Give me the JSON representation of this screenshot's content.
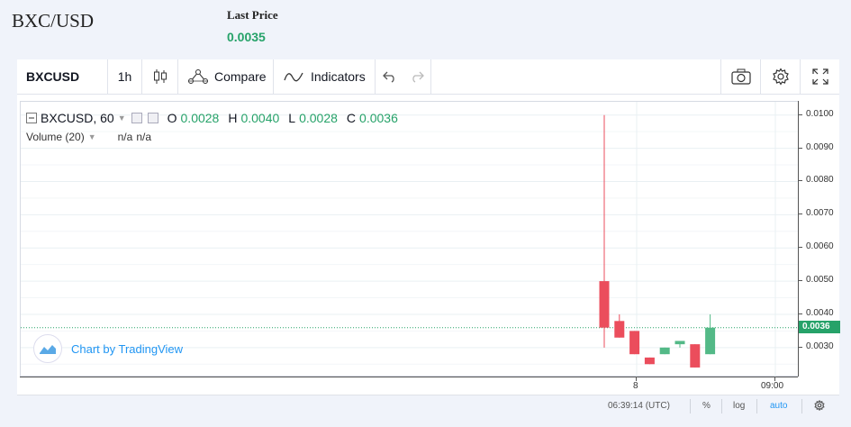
{
  "header": {
    "pair": "BXC/USD",
    "last_price_label": "Last Price",
    "last_price_value": "0.0035"
  },
  "toolbar": {
    "symbol": "BXCUSD",
    "interval": "1h",
    "compare_label": "Compare",
    "indicators_label": "Indicators"
  },
  "legend": {
    "symbol": "BXCUSD, 60",
    "o_label": "O",
    "o_value": "0.0028",
    "h_label": "H",
    "h_value": "0.0040",
    "l_label": "L",
    "l_value": "0.0028",
    "c_label": "C",
    "c_value": "0.0036",
    "volume_label": "Volume (20)",
    "volume_na1": "n/a",
    "volume_na2": "n/a"
  },
  "watermark": "Chart by TradingView",
  "bottom_bar": {
    "time": "06:39:14 (UTC)",
    "percent": "%",
    "log": "log",
    "auto": "auto"
  },
  "chart_data": {
    "type": "candlestick",
    "price_ticks": [
      "0.0100",
      "0.0090",
      "0.0080",
      "0.0070",
      "0.0060",
      "0.0050",
      "0.0040",
      "0.0030"
    ],
    "ylim": [
      0.0021,
      0.0104
    ],
    "time_ticks": [
      "8",
      "09:00"
    ],
    "current_price": "0.0036",
    "candles": [
      {
        "o": 0.005,
        "h": 0.01,
        "l": 0.003,
        "c": 0.0036
      },
      {
        "o": 0.0038,
        "h": 0.004,
        "l": 0.0033,
        "c": 0.0033
      },
      {
        "o": 0.0035,
        "h": 0.0035,
        "l": 0.0028,
        "c": 0.0028
      },
      {
        "o": 0.0027,
        "h": 0.0027,
        "l": 0.0025,
        "c": 0.0025
      },
      {
        "o": 0.0028,
        "h": 0.003,
        "l": 0.0028,
        "c": 0.003
      },
      {
        "o": 0.0031,
        "h": 0.0032,
        "l": 0.003,
        "c": 0.0032
      },
      {
        "o": 0.0031,
        "h": 0.0031,
        "l": 0.0024,
        "c": 0.0024
      },
      {
        "o": 0.0028,
        "h": 0.004,
        "l": 0.0028,
        "c": 0.0036
      }
    ],
    "colors": {
      "up": "#53b987",
      "down": "#eb4d5c",
      "grid": "#e9f0f3"
    }
  }
}
